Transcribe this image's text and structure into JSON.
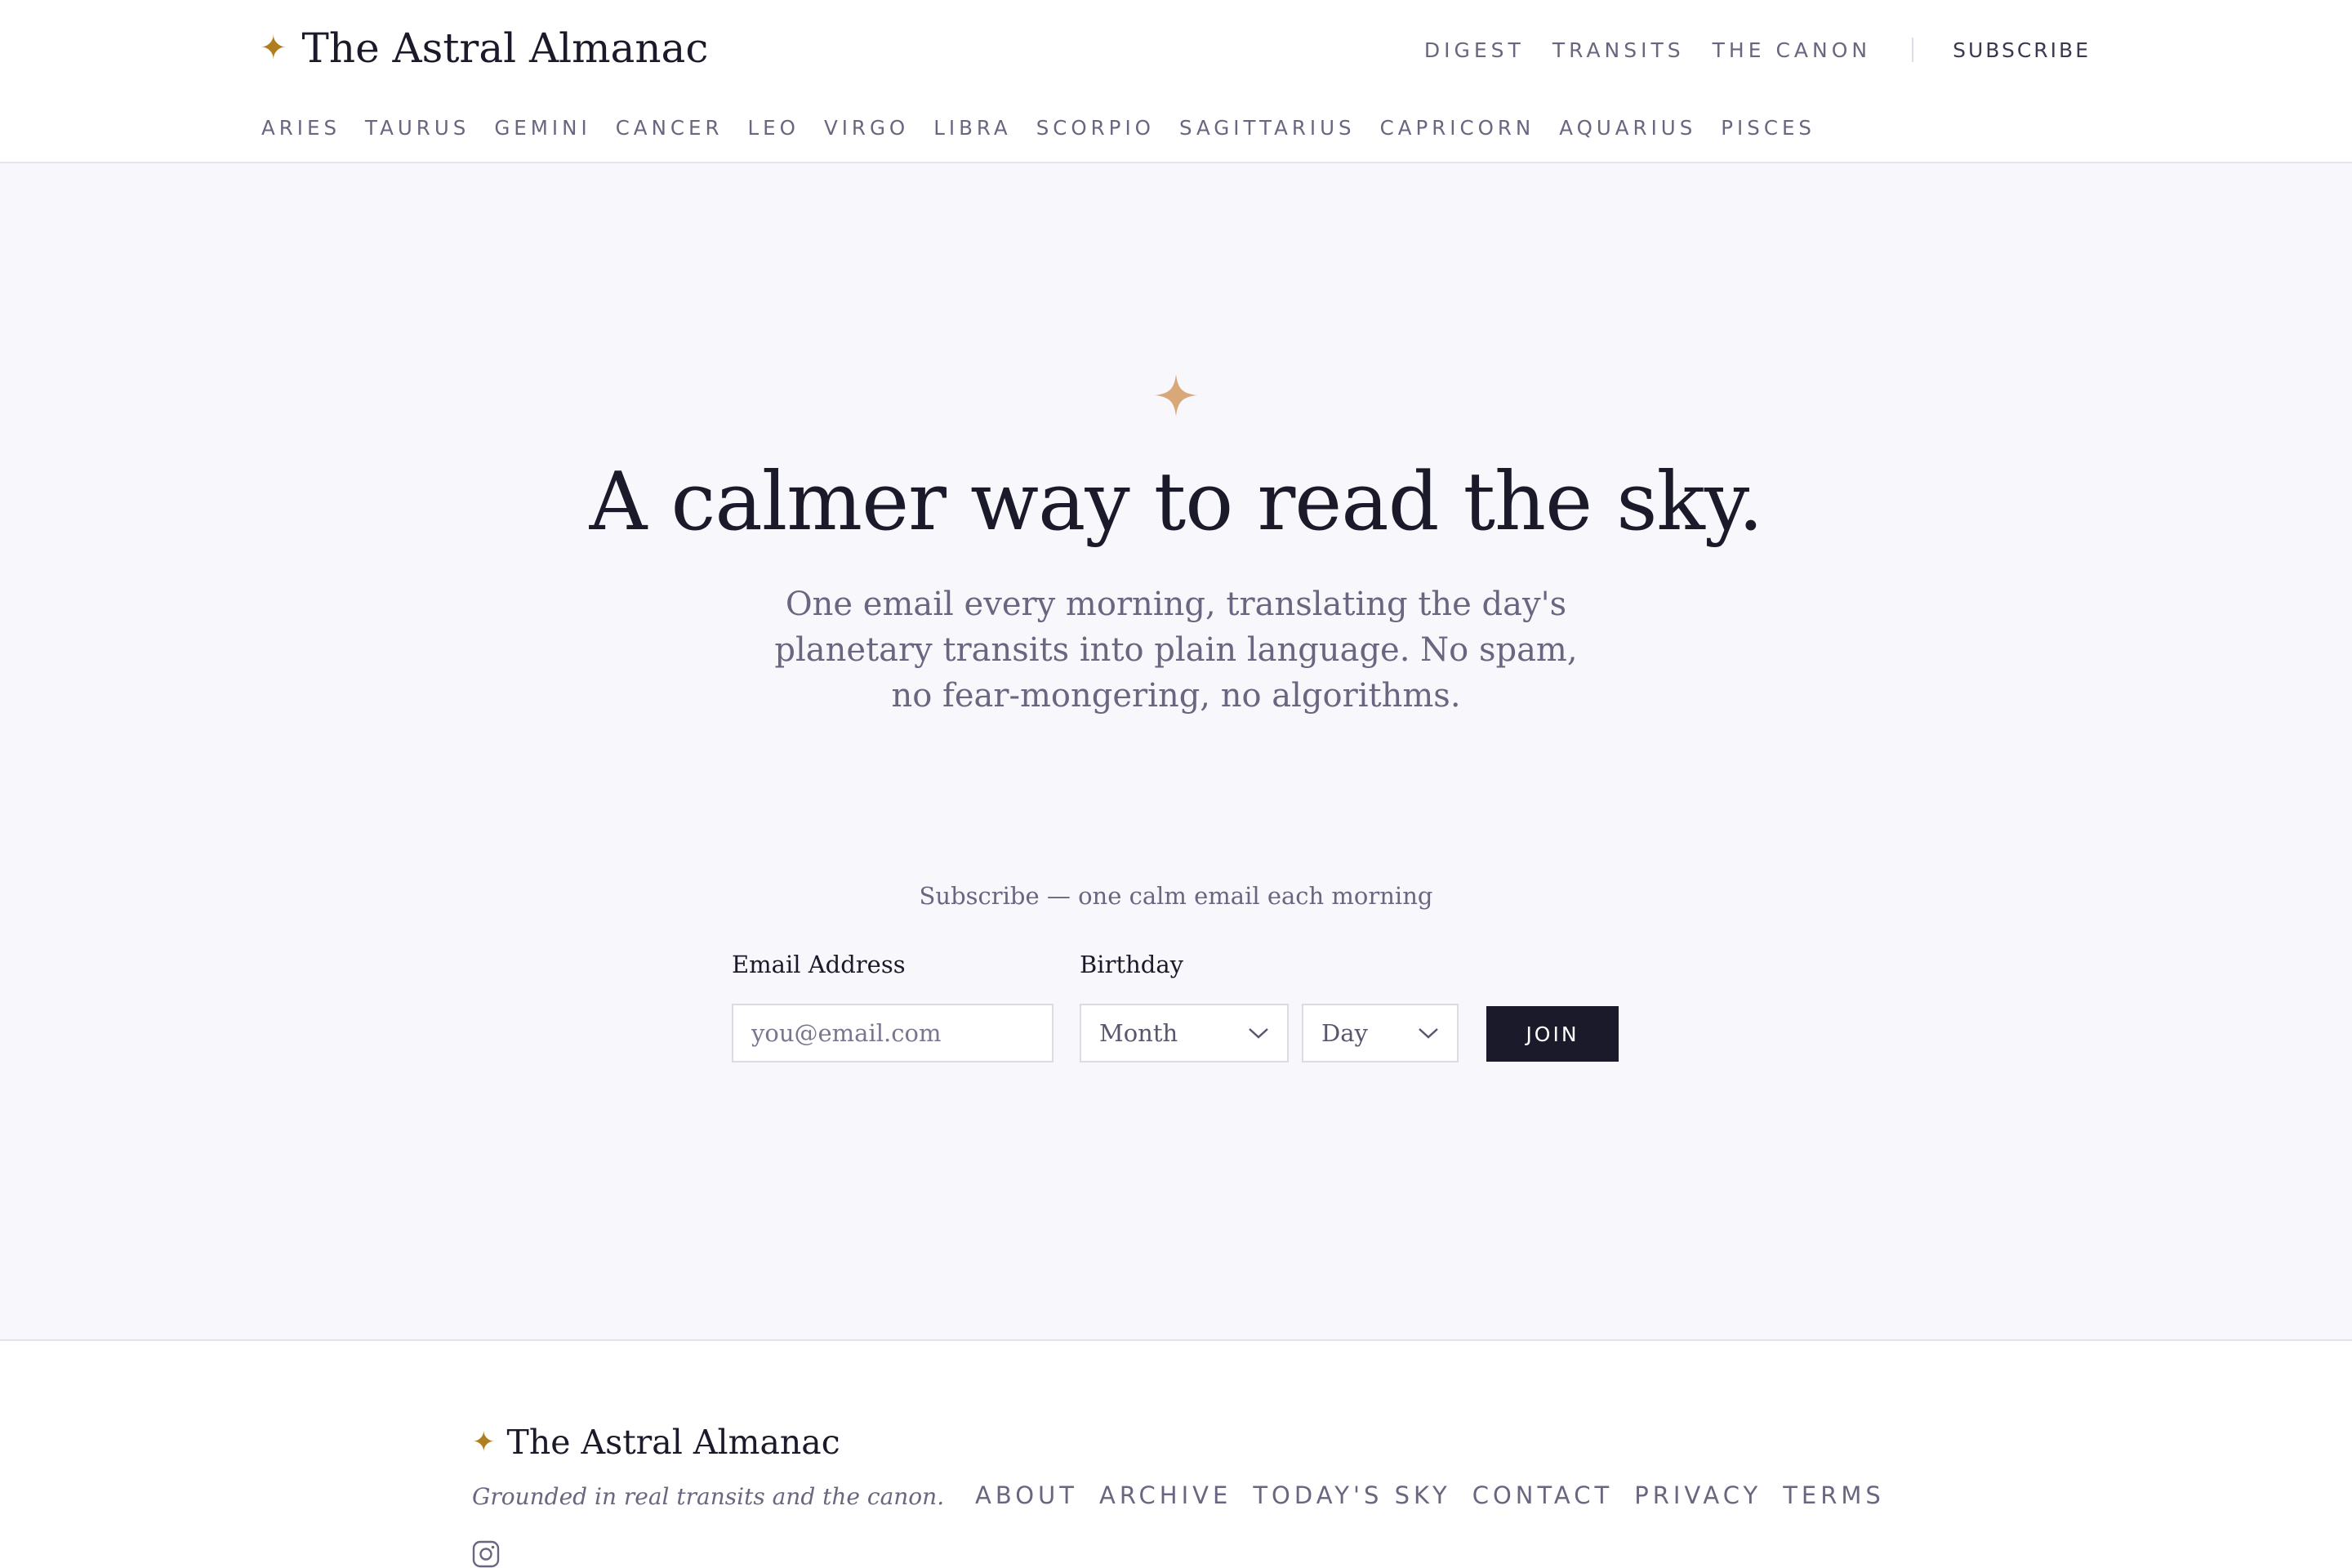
{
  "brand": {
    "icon": "four-point-star-icon",
    "name": "The Astral Almanac"
  },
  "topnav": {
    "items": [
      {
        "label": "DIGEST"
      },
      {
        "label": "TRANSITS"
      },
      {
        "label": "THE CANON"
      }
    ],
    "subscribe": "SUBSCRIBE"
  },
  "signs": [
    "ARIES",
    "TAURUS",
    "GEMINI",
    "CANCER",
    "LEO",
    "VIRGO",
    "LIBRA",
    "SCORPIO",
    "SAGITTARIUS",
    "CAPRICORN",
    "AQUARIUS",
    "PISCES"
  ],
  "hero": {
    "icon": "four-point-star-icon",
    "headline": "A calmer way to read the sky.",
    "lede": "One email every morning, translating the day's planetary transits into plain language. No spam, no fear-mongering, no algorithms."
  },
  "form": {
    "caption": "Subscribe — one calm email each morning",
    "email_label": "Email Address",
    "email_placeholder": "you@email.com",
    "email_value": "",
    "birthday_label": "Birthday",
    "month_value": "Month",
    "day_value": "Day",
    "join_label": "JOIN"
  },
  "footer": {
    "brand_name": "The Astral Almanac",
    "tagline": "Grounded in real transits and the canon.",
    "links": [
      "ABOUT",
      "ARCHIVE",
      "TODAY'S SKY",
      "CONTACT",
      "PRIVACY",
      "TERMS"
    ],
    "social_icon": "instagram-icon"
  },
  "colors": {
    "accent_star": "#b07d1f",
    "hero_star": "#d8a878",
    "ink": "#1b1a2a",
    "muted": "#6a6680",
    "hero_bg": "#f8f7fc"
  }
}
